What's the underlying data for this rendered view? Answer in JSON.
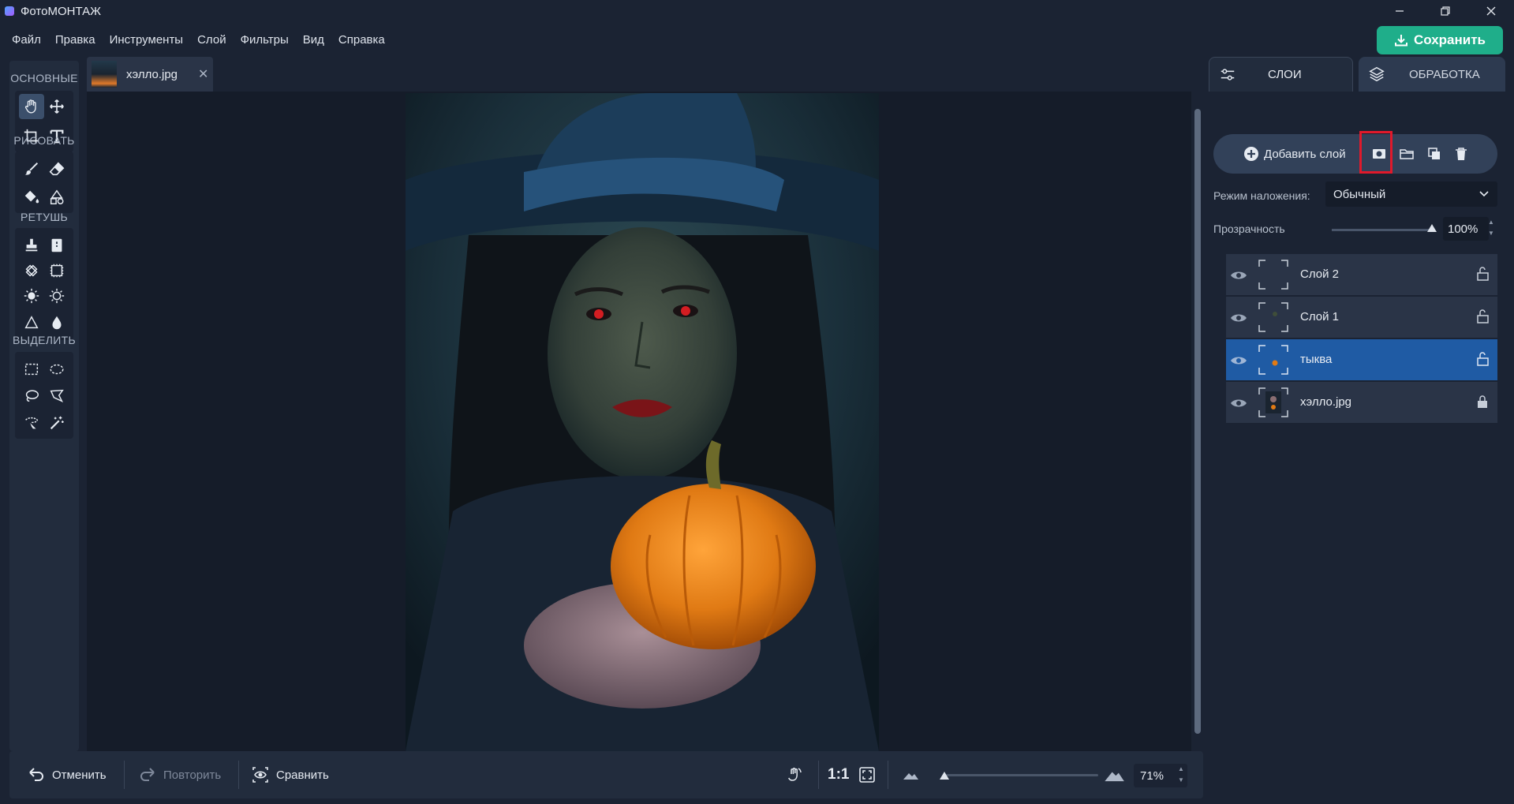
{
  "window": {
    "title": "ФотоМОНТАЖ",
    "controls": [
      "minimize",
      "restore",
      "close"
    ]
  },
  "menu": [
    "Файл",
    "Правка",
    "Инструменты",
    "Слой",
    "Фильтры",
    "Вид",
    "Справка"
  ],
  "save_button": {
    "label": "Сохранить",
    "color": "#1fae8a"
  },
  "tools": {
    "sections": [
      {
        "label": "ОСНОВНЫЕ",
        "tools": [
          "hand-icon",
          "move-icon",
          "crop-icon",
          "text-icon"
        ]
      },
      {
        "label": "РИСОВАТЬ",
        "tools": [
          "brush-icon",
          "eraser-icon",
          "fill-icon",
          "shapes-icon"
        ]
      },
      {
        "label": "РЕТУШЬ",
        "tools": [
          "stamp-icon",
          "heal-icon",
          "patch-icon",
          "retouch-frame-icon",
          "dodge-icon",
          "burn-icon",
          "sharpen-icon",
          "blur-icon"
        ]
      },
      {
        "label": "ВЫДЕЛИТЬ",
        "tools": [
          "rect-select-icon",
          "ellipse-select-icon",
          "lasso-icon",
          "poly-lasso-icon",
          "magnetic-lasso-icon",
          "magic-wand-icon"
        ]
      }
    ],
    "active_tool": "hand-icon"
  },
  "document": {
    "tab_name": "хэлло.jpg"
  },
  "bottom_bar": {
    "undo_label": "Отменить",
    "redo_label": "Повторить",
    "compare_label": "Сравнить",
    "ratio_label": "1:1",
    "zoom_value": "71%",
    "zoom_fraction": 0.0
  },
  "right_panel": {
    "tabs": [
      {
        "label": "СЛОИ",
        "active": true
      },
      {
        "label": "ОБРАБОТКА",
        "active": false
      }
    ],
    "add_layer_label": "Добавить слой",
    "blend_mode_label": "Режим наложения:",
    "blend_mode_value": "Обычный",
    "opacity_label": "Прозрачность",
    "opacity_value": "100%",
    "highlight_color": "#e0192b",
    "layers": [
      {
        "name": "Слой 2",
        "selected": false,
        "locked": false
      },
      {
        "name": "Слой 1",
        "selected": false,
        "locked": false
      },
      {
        "name": "тыква",
        "selected": true,
        "locked": false
      },
      {
        "name": "хэлло.jpg",
        "selected": false,
        "locked": true
      }
    ]
  }
}
